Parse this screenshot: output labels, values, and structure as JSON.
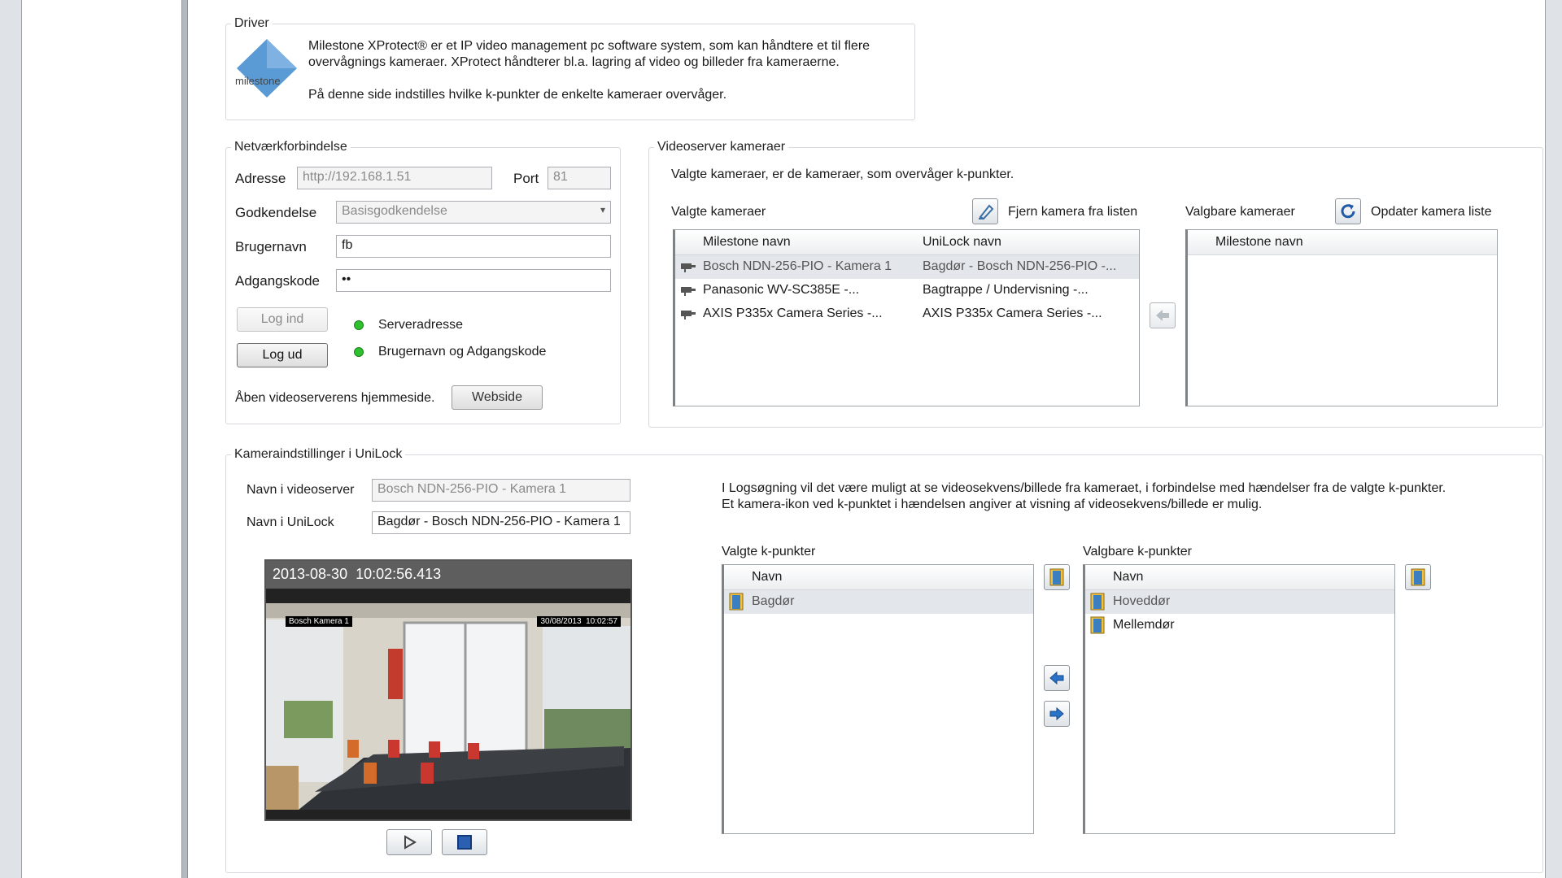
{
  "driver": {
    "legend": "Driver",
    "logo_text": "milestone",
    "description_line1": "Milestone XProtect® er et IP video management pc software system, som kan håndtere et til flere",
    "description_line2": "overvågnings kameraer. XProtect håndterer bl.a. lagring af video og billeder fra kameraerne.",
    "description_line3": "På denne side indstilles hvilke k-punkter de enkelte kameraer overvåger."
  },
  "network": {
    "legend": "Netværkforbindelse",
    "address_label": "Adresse",
    "address_value": "http://192.168.1.51",
    "port_label": "Port",
    "port_value": "81",
    "auth_label": "Godkendelse",
    "auth_value": "Basisgodkendelse",
    "username_label": "Brugernavn",
    "username_value": "fb",
    "password_label": "Adgangskode",
    "password_value": "••",
    "login_label": "Log ind",
    "logout_label": "Log ud",
    "status_server": "Serveradresse",
    "status_credentials": "Brugernavn og Adgangskode",
    "status_color": "#2fbf2f",
    "homepage_label": "Åben videoserverens hjemmeside.",
    "webpage_button": "Webside"
  },
  "videoserver": {
    "legend": "Videoserver kameraer",
    "intro": "Valgte kameraer, er de kameraer, som overvåger k-punkter.",
    "selected_label": "Valgte kameraer",
    "remove_label": "Fjern kamera fra listen",
    "available_label": "Valgbare kameraer",
    "update_label": "Opdater kamera liste",
    "col_milestone": "Milestone navn",
    "col_unilock": "UniLock navn",
    "cameras": [
      {
        "milestone": "Bosch NDN-256-PIO - Kamera 1",
        "unilock": "Bagdør - Bosch NDN-256-PIO -..."
      },
      {
        "milestone": "Panasonic WV-SC385E -...",
        "unilock": "Bagtrappe / Undervisning -..."
      },
      {
        "milestone": "AXIS P335x Camera Series -...",
        "unilock": "AXIS P335x Camera Series -..."
      }
    ],
    "available_col": "Milestone navn"
  },
  "camera_settings": {
    "legend": "Kameraindstillinger i UniLock",
    "name_video_label": "Navn i videoserver",
    "name_video_value": "Bosch NDN-256-PIO - Kamera 1",
    "name_unilock_label": "Navn i UniLock",
    "name_unilock_value": "Bagdør - Bosch NDN-256-PIO - Kamera 1",
    "preview_timestamp": "2013-08-30  10:02:56.413",
    "overlay_left": "Bosch Kamera 1",
    "overlay_right": "30/08/2013  10:02:57",
    "info_line1": "I Logsøgning vil det være muligt at se videosekvens/billede fra kameraet, i forbindelse med hændelser fra de valgte k-punkter.",
    "info_line2": "Et kamera-ikon ved k-punktet i hændelsen angiver at visning af videosekvens/billede er mulig.",
    "selected_kp_label": "Valgte k-punkter",
    "available_kp_label": "Valgbare k-punkter",
    "col_name": "Navn",
    "selected_kp": [
      "Bagdør"
    ],
    "available_kp": [
      "Hoveddør",
      "Mellemdør"
    ]
  }
}
